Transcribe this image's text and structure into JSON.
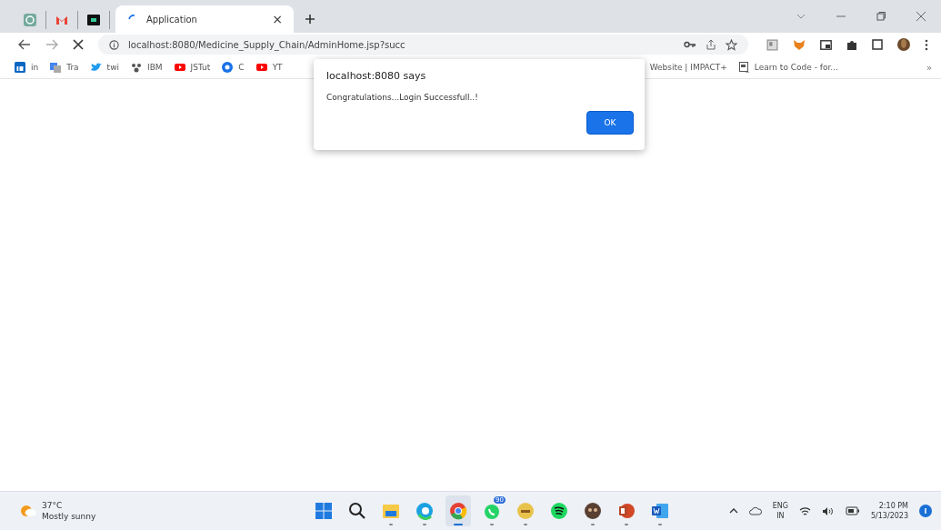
{
  "tabs": {
    "pinned": [
      {
        "kind": "chatgpt"
      },
      {
        "kind": "gmail"
      },
      {
        "kind": "terminal"
      }
    ],
    "active_tab": {
      "title": "Application",
      "close": "×",
      "loading": true
    }
  },
  "address_bar": {
    "url": "localhost:8080/Medicine_Supply_Chain/AdminHome.jsp?succ"
  },
  "bookmarks": {
    "left": [
      {
        "label": "in",
        "kind": "linkedin"
      },
      {
        "label": "Tra",
        "kind": "translate"
      },
      {
        "label": "twi",
        "kind": "twitter"
      },
      {
        "label": "IBM",
        "kind": "ibm"
      },
      {
        "label": "JSTut",
        "kind": "youtube"
      },
      {
        "label": "C",
        "kind": "circle"
      },
      {
        "label": "YT",
        "kind": "youtube"
      }
    ],
    "right": [
      {
        "label": "Website | IMPACT+",
        "kind": "none"
      },
      {
        "label": "Learn to Code - for...",
        "kind": "page"
      }
    ],
    "more": "»"
  },
  "dialog": {
    "title": "localhost:8080 says",
    "message": "Congratulations...Login Successfull..!",
    "button": "OK"
  },
  "taskbar": {
    "weather": {
      "temperature": "37°C",
      "condition": "Mostly sunny"
    },
    "apps": [
      {
        "kind": "start",
        "running": false,
        "active": false
      },
      {
        "kind": "search",
        "running": false,
        "active": false
      },
      {
        "kind": "folder",
        "running": true,
        "active": false
      },
      {
        "kind": "edge",
        "running": true,
        "active": false
      },
      {
        "kind": "chrome",
        "running": true,
        "active": true
      },
      {
        "kind": "chat",
        "running": true,
        "active": false,
        "badge": "90"
      },
      {
        "kind": "hs",
        "running": true,
        "active": false
      },
      {
        "kind": "music",
        "running": false,
        "active": false
      },
      {
        "kind": "owl",
        "running": true,
        "active": false
      },
      {
        "kind": "slides",
        "running": true,
        "active": false
      },
      {
        "kind": "word",
        "running": true,
        "active": false
      }
    ],
    "tray": {
      "language": "ENG",
      "region": "IN",
      "time": "2:10 PM",
      "date": "5/13/2023"
    }
  }
}
